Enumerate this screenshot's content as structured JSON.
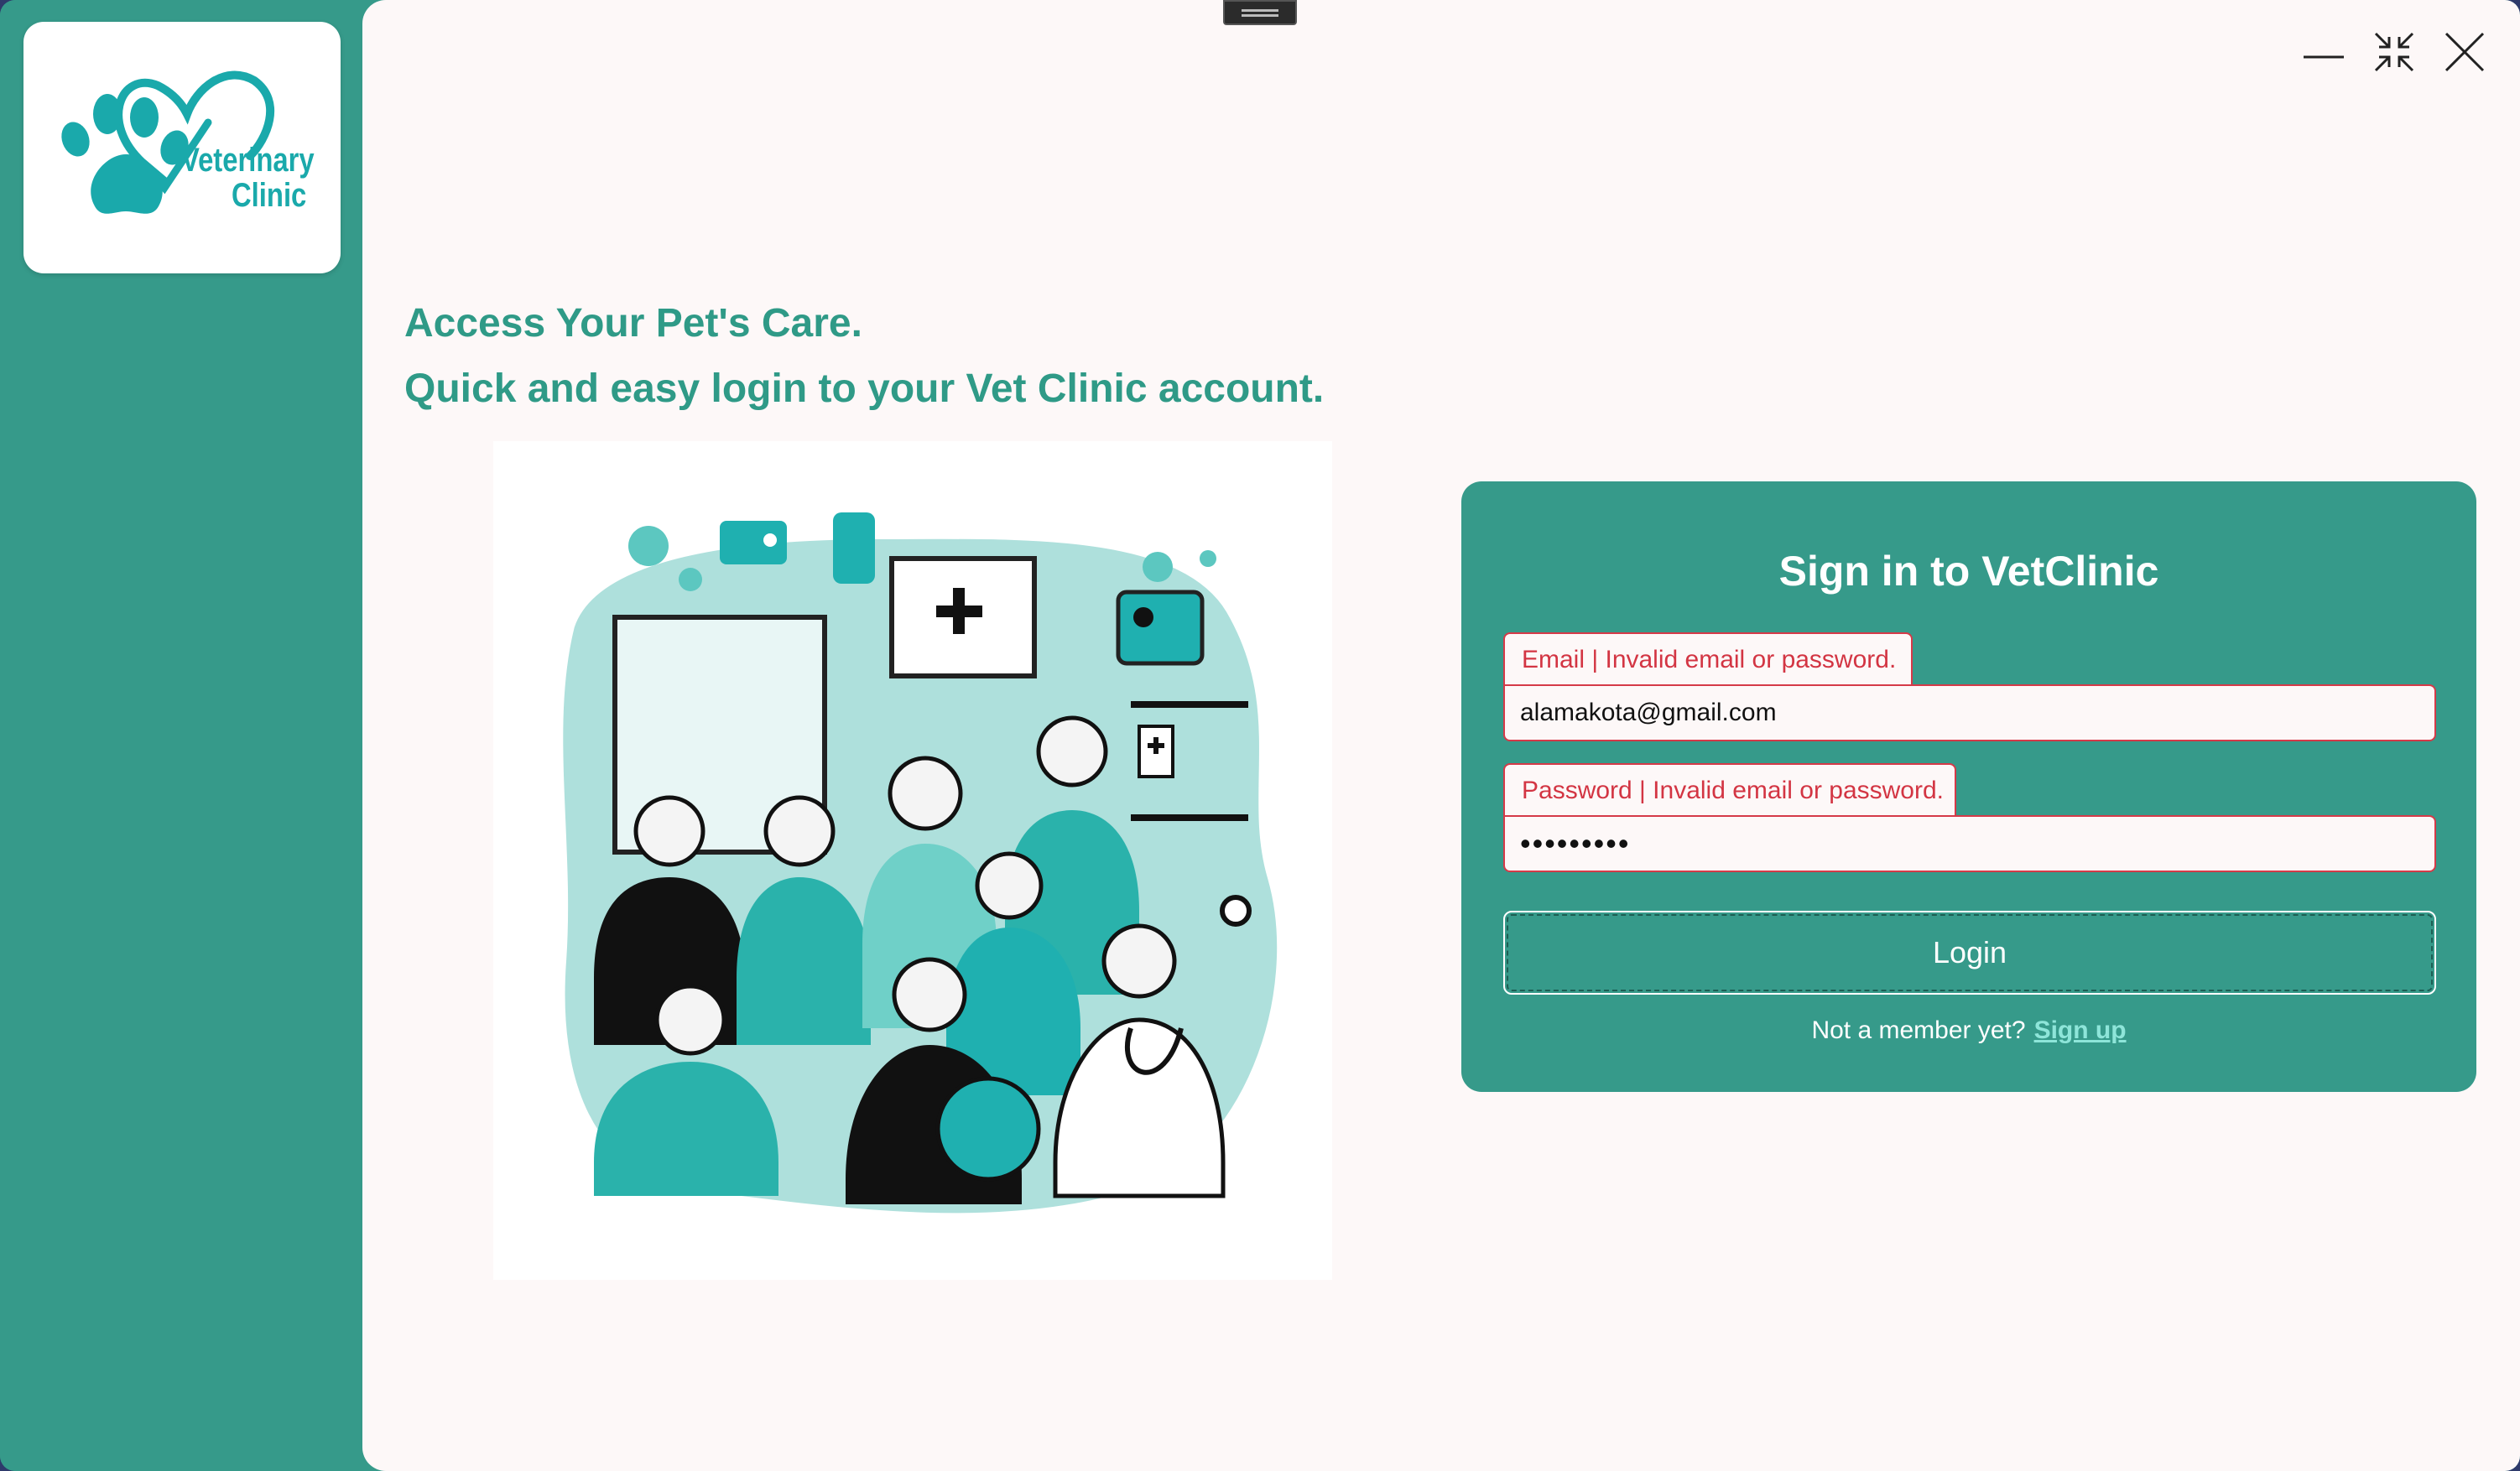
{
  "logo": {
    "line1": "Veterinary",
    "line2": "Clinic"
  },
  "window_controls": {
    "minimize": "minimize-icon",
    "restore": "restore-icon",
    "close": "close-icon"
  },
  "headline": {
    "line1": "Access Your Pet's Care.",
    "line2": "Quick and easy login to your Vet Clinic account."
  },
  "signin": {
    "title": "Sign in to VetClinic",
    "email_label": "Email  | Invalid email or password.",
    "email_value": "alamakota@gmail.com",
    "password_label": "Password  | Invalid email or password.",
    "password_value": "123456789",
    "login_label": "Login",
    "prompt": "Not a member yet?",
    "signup_label": "Sign up"
  },
  "colors": {
    "brand_teal": "#369a8a",
    "logo_teal": "#1aa9ab",
    "error_red": "#d33543",
    "page_bg": "#fdf8f8",
    "link": "#8ee5d9"
  }
}
